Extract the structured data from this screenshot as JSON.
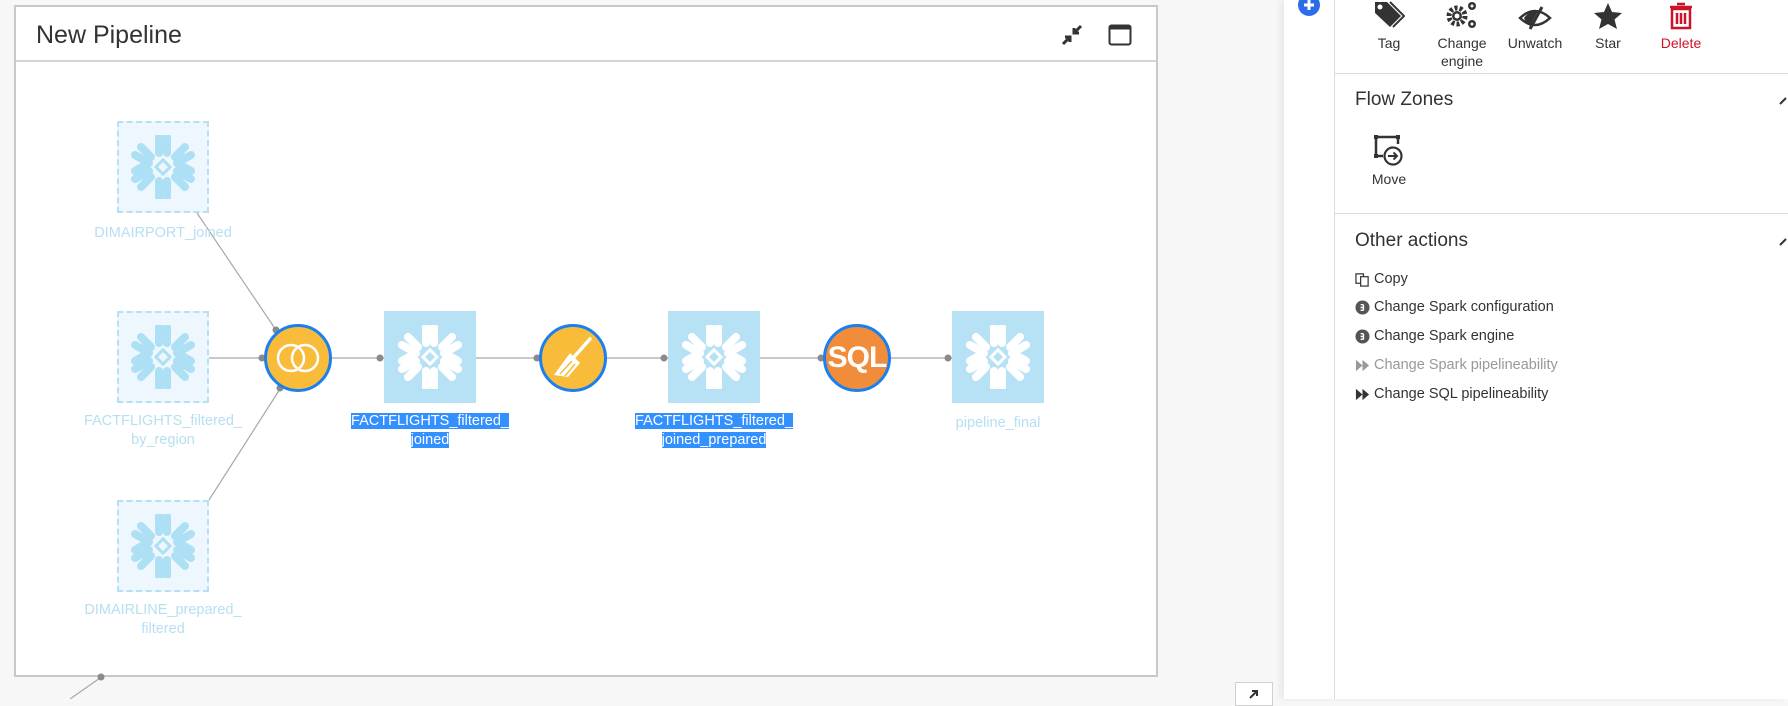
{
  "frame": {
    "title": "New Pipeline",
    "icons": {
      "collapse": "collapse-arrows-icon",
      "window": "window-icon"
    }
  },
  "flow": {
    "datasets": [
      {
        "id": "dimairport",
        "label_lines": [
          "DIMAIRPORT_joined"
        ],
        "style": "ghost",
        "selected": false,
        "icon": "snowflake-icon"
      },
      {
        "id": "factflights_region",
        "label_lines": [
          "FACTFLIGHTS_filtered_",
          "by_region"
        ],
        "style": "ghost",
        "selected": false,
        "icon": "snowflake-icon"
      },
      {
        "id": "dimairline",
        "label_lines": [
          "DIMAIRLINE_prepared_",
          "filtered"
        ],
        "style": "ghost",
        "selected": false,
        "icon": "snowflake-icon"
      },
      {
        "id": "ff_joined",
        "label_lines": [
          "FACTFLIGHTS_filtered_",
          "joined"
        ],
        "style": "solid",
        "selected": true,
        "icon": "snowflake-icon"
      },
      {
        "id": "ff_joined_prepared",
        "label_lines": [
          "FACTFLIGHTS_filtered_",
          "joined_prepared"
        ],
        "style": "solid",
        "selected": true,
        "icon": "snowflake-icon"
      },
      {
        "id": "pipeline_final",
        "label_lines": [
          "pipeline_final"
        ],
        "style": "solid-ghostlabel",
        "selected": false,
        "icon": "snowflake-icon"
      }
    ],
    "recipes": [
      {
        "id": "join",
        "type": "join",
        "icon": "join-icon",
        "color": "#f8bb3a"
      },
      {
        "id": "prepare",
        "type": "prepare",
        "icon": "broom-icon",
        "color": "#f8bb3a"
      },
      {
        "id": "sql",
        "type": "sql",
        "icon": "sql-icon",
        "text": "SQL",
        "color": "#f08c3a"
      }
    ],
    "colors": {
      "selection": "#3390ff",
      "recipe_border": "#1a7ff0",
      "dataset_fill": "#b7e1f4"
    }
  },
  "panel": {
    "actions": [
      {
        "label": "Tag",
        "icon": "tag-icon"
      },
      {
        "label": "Change engine",
        "icon": "gears-icon"
      },
      {
        "label": "Unwatch",
        "icon": "eye-slash-icon"
      },
      {
        "label": "Star",
        "icon": "star-icon"
      },
      {
        "label": "Delete",
        "icon": "trash-icon",
        "danger": true
      }
    ],
    "flow_zones": {
      "title": "Flow Zones",
      "items": [
        {
          "label": "Move",
          "icon": "move-zone-icon"
        }
      ]
    },
    "other_actions": {
      "title": "Other actions",
      "items": [
        {
          "label": "Copy",
          "icon": "copy-icon",
          "enabled": true
        },
        {
          "label": "Change Spark configuration",
          "icon": "spark-icon",
          "enabled": true
        },
        {
          "label": "Change Spark engine",
          "icon": "spark-icon",
          "enabled": true
        },
        {
          "label": "Change Spark pipelineability",
          "icon": "fast-forward-icon",
          "enabled": false
        },
        {
          "label": "Change SQL pipelineability",
          "icon": "fast-forward-icon",
          "enabled": true
        }
      ]
    },
    "danger_color": "#ce1228"
  }
}
